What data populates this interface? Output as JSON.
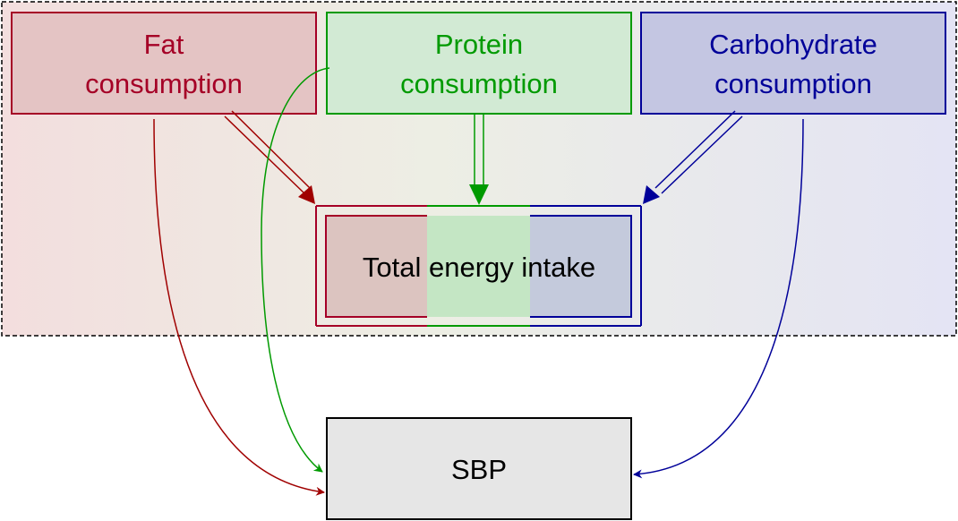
{
  "nodes": {
    "fat": {
      "line1": "Fat",
      "line2": "consumption"
    },
    "protein": {
      "line1": "Protein",
      "line2": "consumption"
    },
    "carbohydrate": {
      "line1": "Carbohydrate",
      "line2": "consumption"
    },
    "total_energy": {
      "label": "Total energy intake"
    },
    "sbp": {
      "label": "SBP"
    }
  },
  "colors": {
    "fat": "#A50026",
    "fat_arrow": "#A00000",
    "protein": "#009A00",
    "carbohydrate": "#000099",
    "text": "#000000",
    "border": "#000000"
  }
}
